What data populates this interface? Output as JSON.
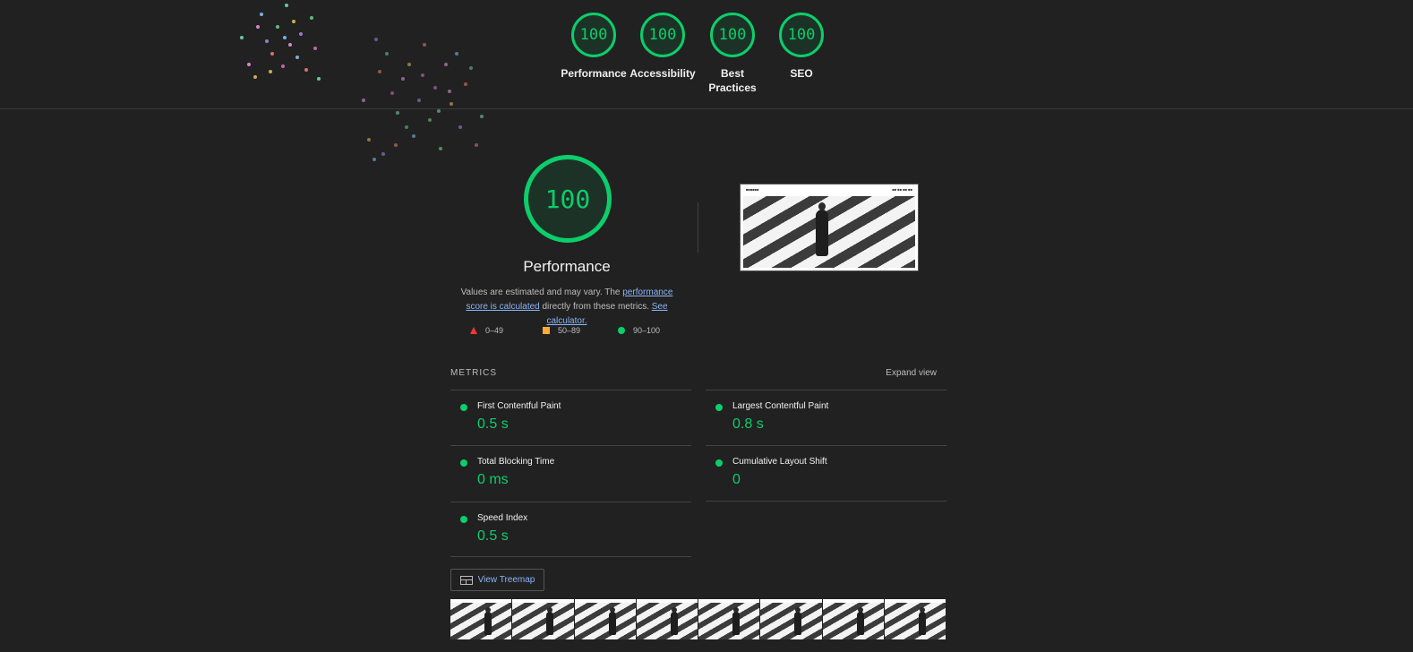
{
  "scores": [
    {
      "label": "Performance",
      "value": "100"
    },
    {
      "label": "Accessibility",
      "value": "100"
    },
    {
      "label": "Best Practices",
      "value": "100"
    },
    {
      "label": "SEO",
      "value": "100"
    }
  ],
  "performance": {
    "score": "100",
    "title": "Performance",
    "desc_prefix": "Values are estimated and may vary. The ",
    "desc_link1": "performance score is calculated",
    "desc_middle": " directly from these metrics. ",
    "desc_link2": "See calculator."
  },
  "legend": {
    "fail": "0–49",
    "average": "50–89",
    "pass": "90–100"
  },
  "metrics": {
    "header": "METRICS",
    "expand": "Expand view",
    "items": [
      {
        "name": "First Contentful Paint",
        "value": "0.5 s"
      },
      {
        "name": "Largest Contentful Paint",
        "value": "0.8 s"
      },
      {
        "name": "Total Blocking Time",
        "value": "0 ms"
      },
      {
        "name": "Cumulative Layout Shift",
        "value": "0"
      },
      {
        "name": "Speed Index",
        "value": "0.5 s"
      }
    ]
  },
  "treemap_button": "View Treemap",
  "colors": {
    "pass": "#0cce6b",
    "average": "#ffaa33",
    "fail": "#ff3333",
    "background": "#212121",
    "link": "#8ab4f8"
  }
}
